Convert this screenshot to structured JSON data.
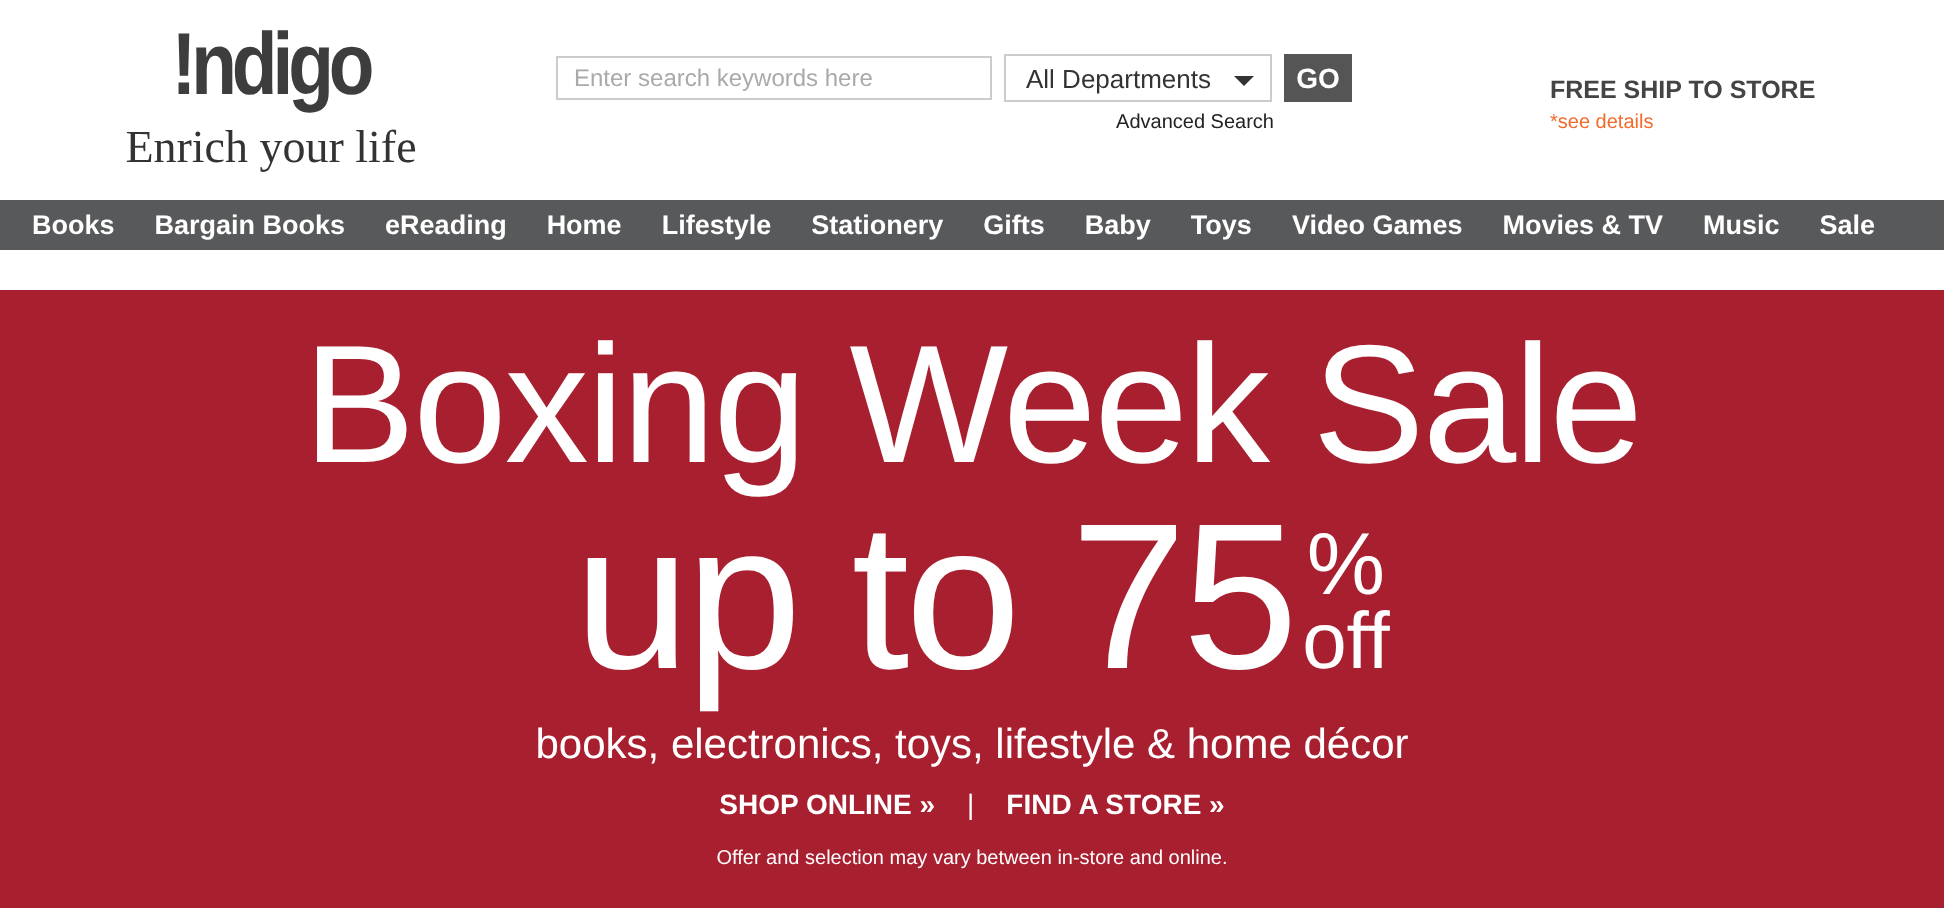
{
  "header": {
    "logo": "!ndigo",
    "tagline": "Enrich your life",
    "search": {
      "placeholder": "Enter search keywords here"
    },
    "department": "All Departments",
    "go_button": "GO",
    "advanced_search": "Advanced Search",
    "promo_title": "FREE SHIP TO STORE",
    "promo_link": "*see details"
  },
  "nav": [
    "Books",
    "Bargain Books",
    "eReading",
    "Home",
    "Lifestyle",
    "Stationery",
    "Gifts",
    "Baby",
    "Toys",
    "Video Games",
    "Movies & TV",
    "Music",
    "Sale"
  ],
  "banner": {
    "headline": "Boxing Week Sale",
    "discount_prefix": "up to 75",
    "percent": "%",
    "off": "off",
    "subtitle": "books, electronics, toys, lifestyle & home décor",
    "links": [
      "SHOP ONLINE »",
      "FIND A STORE »"
    ],
    "separator": "|",
    "fine_print": "Offer and selection may vary between in-store and online."
  }
}
